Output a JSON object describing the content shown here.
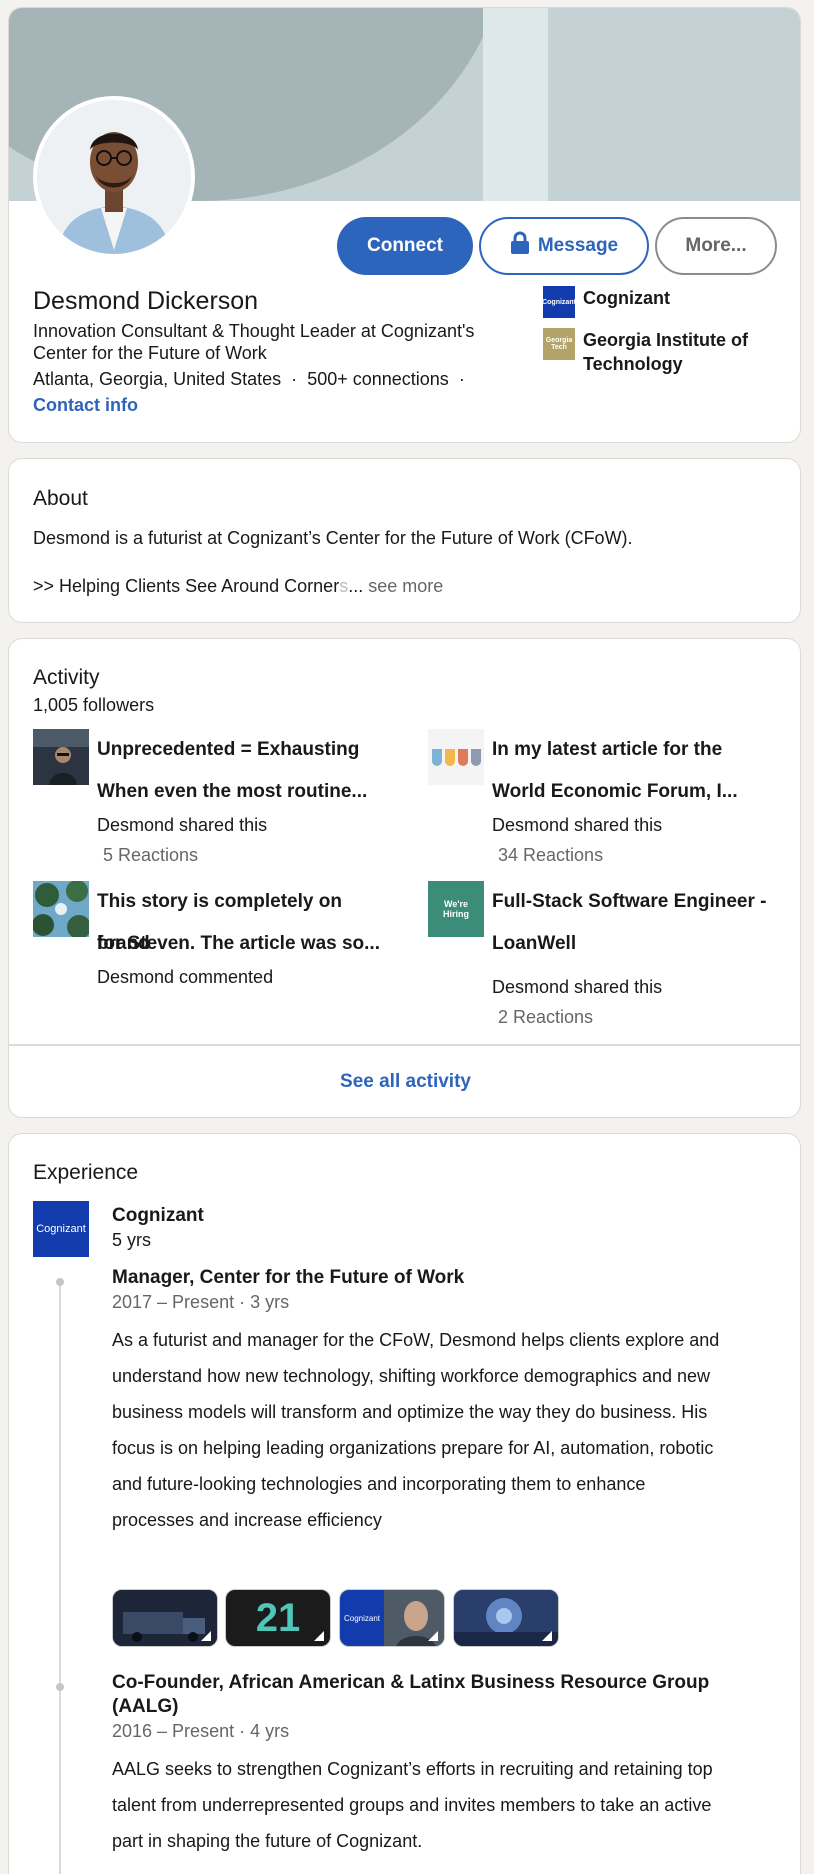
{
  "profile": {
    "name": "Desmond Dickerson",
    "headline": "Innovation Consultant & Thought Leader at Cognizant's Center for the Future of Work",
    "location": "Atlanta, Georgia, United States",
    "separator": "·",
    "connections": "500+ connections",
    "contact_info": "Contact info",
    "buttons": {
      "connect": "Connect",
      "message": "Message",
      "more": "More..."
    },
    "orgs": [
      {
        "name": "Cognizant",
        "logo_text": "Cognizant",
        "color": "#123bae"
      },
      {
        "name": "Georgia Institute of Technology",
        "logo_text": "Georgia Tech",
        "color": "#b3a369"
      }
    ]
  },
  "about": {
    "title": "About",
    "line1": "Desmond is a futurist at Cognizant’s Center for the Future of Work (CFoW).",
    "line2_visible": ">> Helping Clients See Around Corner",
    "line2_faded": "s",
    "ellipsis": "...",
    "see_more": "see more"
  },
  "activity": {
    "title": "Activity",
    "followers": "1,005 followers",
    "posts": [
      {
        "title_line1": "Unprecedented = Exhausting",
        "title_line2": "When even the most routine...",
        "meta": "Desmond shared this",
        "reactions": "5 Reactions"
      },
      {
        "title_line1": "In my latest article for the",
        "title_line2": "World Economic Forum, I...",
        "meta": "Desmond shared this",
        "reactions": "34 Reactions"
      },
      {
        "title_line1": "This story is completely on brand",
        "title_line2": "for Steven. The article was so...",
        "meta": "Desmond commented",
        "reactions": ""
      },
      {
        "title_line1": "Full-Stack Software Engineer -",
        "title_line2": "LoanWell",
        "meta": "Desmond shared this",
        "reactions": "2 Reactions",
        "thumb_text": "We're Hiring"
      }
    ],
    "see_all": "See all activity"
  },
  "experience": {
    "title": "Experience",
    "company": "Cognizant",
    "company_logo_text": "Cognizant",
    "duration": "5 yrs",
    "roles": [
      {
        "title": "Manager, Center for the Future of Work",
        "dates": "2017 – Present · 3 yrs",
        "description": "As a futurist and manager for the CFoW, Desmond helps clients explore and understand how new technology, shifting workforce demographics and new business models will transform and optimize the way they do business. His focus is on helping leading organizations prepare for AI, automation, robotic and future-looking technologies and incorporating them to enhance processes and increase efficiency",
        "media": [
          {
            "label": ""
          },
          {
            "label": "21"
          },
          {
            "label": "Cognizant"
          },
          {
            "label": ""
          }
        ]
      },
      {
        "title": "Co-Founder, African American & Latinx Business Resource Group (AALG)",
        "dates": "2016 – Present · 4 yrs",
        "description": "AALG seeks to strengthen Cognizant’s efforts in recruiting and retaining top talent from underrepresented groups and invites members to take an active part in shaping the future of Cognizant."
      }
    ]
  },
  "colors": {
    "accent": "#2d64bc",
    "banner": "#c4d1d5",
    "background": "#f3f2ef"
  }
}
